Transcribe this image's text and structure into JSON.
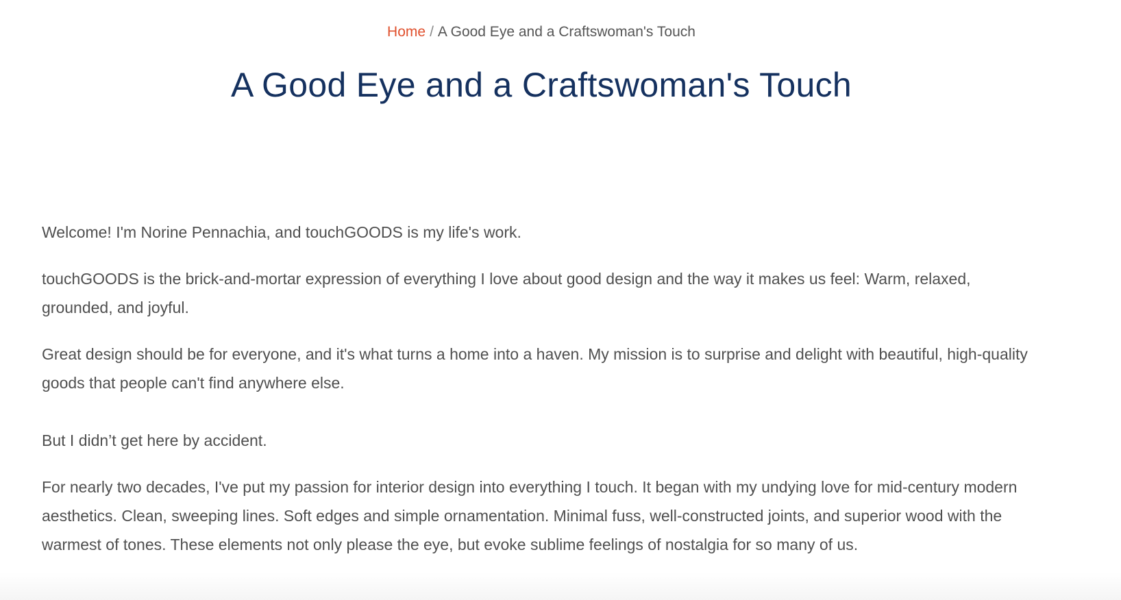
{
  "breadcrumb": {
    "home_label": "Home",
    "separator": "/",
    "current": "A Good Eye and a Craftswoman's Touch"
  },
  "page": {
    "title": "A Good Eye and a Craftswoman's Touch"
  },
  "content": {
    "paragraphs": [
      "Welcome! I'm Norine Pennachia, and touchGOODS is my life's work.",
      "touchGOODS is the brick-and-mortar expression of everything I love about good design and the way it makes us feel: Warm, relaxed, grounded, and joyful.",
      "Great design should be for everyone, and it's what turns a home into a haven. My mission is to surprise and delight with beautiful, high-quality goods that people can't find anywhere else.",
      "But I didn’t get here by accident.",
      "For nearly two decades, I've put my passion for interior design into everything I touch. It began with my undying love for mid-century modern aesthetics. Clean, sweeping lines. Soft edges and simple ornamentation. Minimal fuss, well-constructed joints, and superior wood with the warmest of tones. These elements not only please the eye, but evoke sublime feelings of nostalgia for so many of us."
    ]
  },
  "colors": {
    "link": "#e0502d",
    "title": "#15315f",
    "body_text": "#4f4f4f"
  }
}
